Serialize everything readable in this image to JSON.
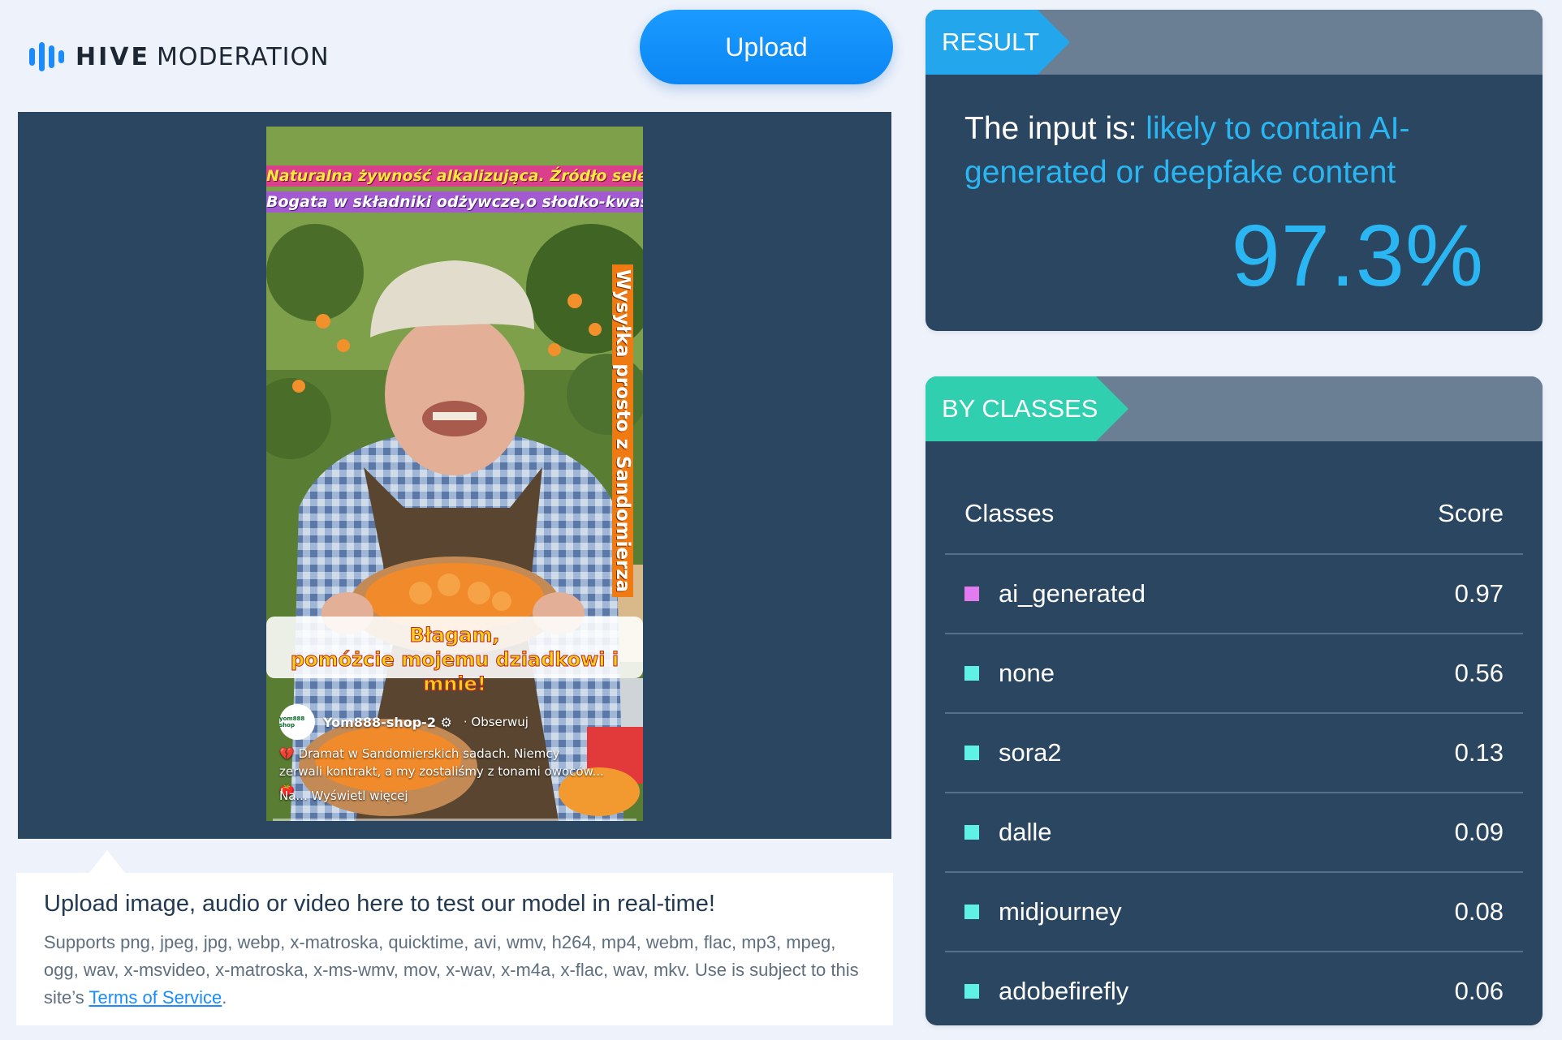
{
  "header": {
    "logo_bold": "HIVE",
    "logo_light": "MODERATION",
    "upload_label": "Upload"
  },
  "preview": {
    "banner_line1": "Naturalna żywność alkalizująca. Źródło selenu i wapnia.",
    "banner_line2": "Bogata w składniki odżywcze,o słodko-kwaśnym smaku",
    "vertical_text": "Wysyłka prosto z Sandomierza",
    "caption_line1": "Błagam,",
    "caption_line2": "pomóżcie mojemu dziadkowi i mnie!",
    "avatar_text": "yom888 shop",
    "username": "Yom888-shop-2 ⚙",
    "follow": "· Obserwuj",
    "description": "💔 Dramat w Sandomierskich sadach. Niemcy zerwali kontrakt, a my zostaliśmy z tonami owoców... 🍅",
    "more": "Na... Wyświetl więcej"
  },
  "info": {
    "title": "Upload image, audio or video here to test our model in real-time!",
    "supports_text": "Supports png, jpeg, jpg, webp, x-matroska, quicktime, avi, wmv, h264, mp4, webm, flac, mp3, mpeg, ogg, wav, x-msvideo, x-matroska, x-ms-wmv, mov, x-wav, x-m4a, x-flac, wav, mkv. Use is subject to this site’s ",
    "terms_link": "Terms of Service",
    "terms_suffix": "."
  },
  "result": {
    "tab_label": "RESULT",
    "prefix": "The input is: ",
    "verdict": "likely to contain AI-generated or deepfake content",
    "percent": "97.3%"
  },
  "classes": {
    "tab_label": "BY CLASSES",
    "col_class": "Classes",
    "col_score": "Score",
    "rows": [
      {
        "name": "ai_generated",
        "score": "0.97",
        "color": "#e27bf0"
      },
      {
        "name": "none",
        "score": "0.56",
        "color": "#5ff0e6"
      },
      {
        "name": "sora2",
        "score": "0.13",
        "color": "#5ff0e6"
      },
      {
        "name": "dalle",
        "score": "0.09",
        "color": "#5ff0e6"
      },
      {
        "name": "midjourney",
        "score": "0.08",
        "color": "#5ff0e6"
      },
      {
        "name": "adobefirefly",
        "score": "0.06",
        "color": "#5ff0e6"
      }
    ]
  },
  "colors": {
    "accent_blue": "#1a8cff",
    "result_blue": "#2ab6f2",
    "classes_teal": "#2fcfaf",
    "panel": "#2b4660"
  }
}
